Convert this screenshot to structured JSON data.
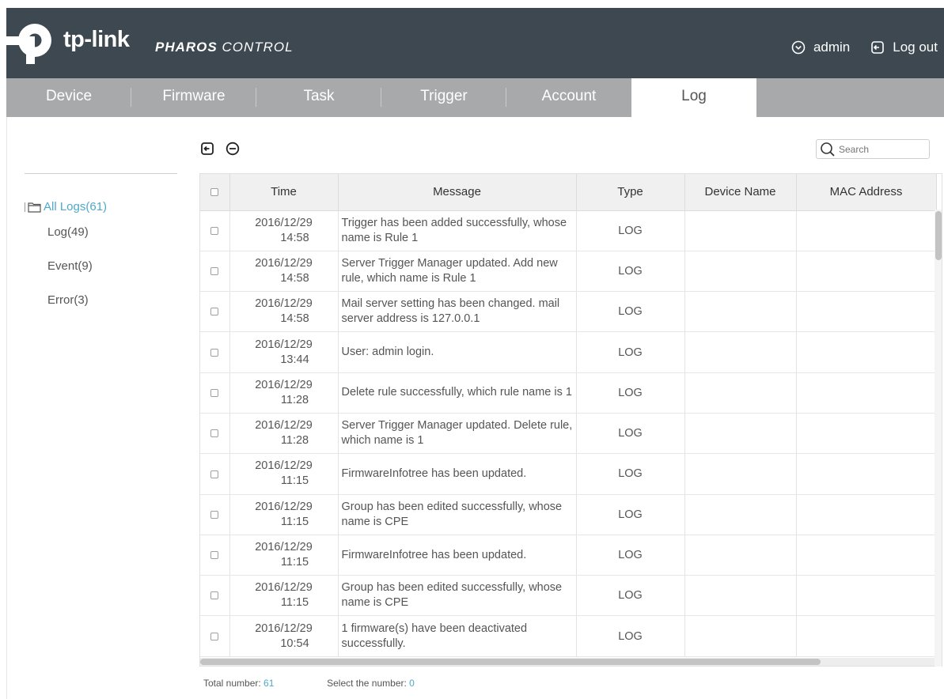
{
  "header": {
    "brand": "tp-link",
    "product_bold": "PHAROS",
    "product_light": "CONTROL",
    "user_label": "admin",
    "logout_label": "Log out",
    "bg_color": "#3d4850"
  },
  "tabs": [
    {
      "label": "Device"
    },
    {
      "label": "Firmware"
    },
    {
      "label": "Task"
    },
    {
      "label": "Trigger"
    },
    {
      "label": "Account"
    },
    {
      "label": "Log",
      "active": true
    }
  ],
  "sidebar": {
    "root": "All Logs(61)",
    "items": [
      "Log(49)",
      "Event(9)",
      "Error(3)"
    ]
  },
  "toolbar": {
    "export_icon": "export-icon",
    "delete_icon": "minus-circle-icon",
    "search_placeholder": "Search"
  },
  "table": {
    "columns": [
      "Time",
      "Message",
      "Type",
      "Device Name",
      "MAC Address"
    ],
    "rows": [
      {
        "date": "2016/12/29",
        "time": "14:58",
        "message": "Trigger has been added successfully, whose name is Rule 1",
        "type": "LOG",
        "device": "",
        "mac": ""
      },
      {
        "date": "2016/12/29",
        "time": "14:58",
        "message": "Server Trigger Manager updated. Add new rule, which name is Rule 1",
        "type": "LOG",
        "device": "",
        "mac": ""
      },
      {
        "date": "2016/12/29",
        "time": "14:58",
        "message": "Mail server setting has been changed. mail server address is 127.0.0.1",
        "type": "LOG",
        "device": "",
        "mac": ""
      },
      {
        "date": "2016/12/29",
        "time": "13:44",
        "message": "User: admin login.",
        "type": "LOG",
        "device": "",
        "mac": ""
      },
      {
        "date": "2016/12/29",
        "time": "11:28",
        "message": "Delete rule successfully, which rule name is 1",
        "type": "LOG",
        "device": "",
        "mac": ""
      },
      {
        "date": "2016/12/29",
        "time": "11:28",
        "message": "Server Trigger Manager updated. Delete rule, which name is 1",
        "type": "LOG",
        "device": "",
        "mac": ""
      },
      {
        "date": "2016/12/29",
        "time": "11:15",
        "message": "FirmwareInfotree has been updated.",
        "type": "LOG",
        "device": "",
        "mac": ""
      },
      {
        "date": "2016/12/29",
        "time": "11:15",
        "message": "Group has been edited successfully, whose name is CPE",
        "type": "LOG",
        "device": "",
        "mac": ""
      },
      {
        "date": "2016/12/29",
        "time": "11:15",
        "message": "FirmwareInfotree has been updated.",
        "type": "LOG",
        "device": "",
        "mac": ""
      },
      {
        "date": "2016/12/29",
        "time": "11:15",
        "message": "Group has been edited successfully, whose name is CPE",
        "type": "LOG",
        "device": "",
        "mac": ""
      },
      {
        "date": "2016/12/29",
        "time": "10:54",
        "message": "1 firmware(s) have been deactivated successfully.",
        "type": "LOG",
        "device": "",
        "mac": ""
      }
    ]
  },
  "footer": {
    "total_label": "Total number: ",
    "total_value": "61",
    "select_label": "Select the number: ",
    "select_value": "0"
  },
  "colors": {
    "accent": "#4fa8c8",
    "tab_bar": "#a7a9ab"
  }
}
